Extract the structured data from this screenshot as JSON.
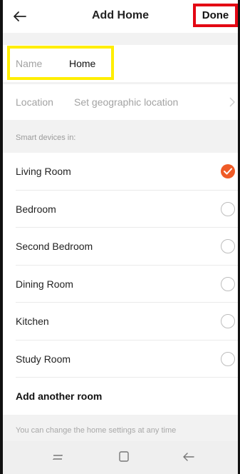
{
  "header": {
    "title": "Add Home",
    "done_label": "Done"
  },
  "name_field": {
    "label": "Name",
    "value": "Home"
  },
  "location_field": {
    "label": "Location",
    "value": "Set geographic location"
  },
  "section": {
    "label": "Smart devices in:"
  },
  "rooms": [
    {
      "label": "Living Room",
      "checked": true
    },
    {
      "label": "Bedroom",
      "checked": false
    },
    {
      "label": "Second Bedroom",
      "checked": false
    },
    {
      "label": "Dining Room",
      "checked": false
    },
    {
      "label": "Kitchen",
      "checked": false
    },
    {
      "label": "Study Room",
      "checked": false
    }
  ],
  "add_room_label": "Add another room",
  "hint": "You can change the home settings at any time",
  "colors": {
    "accent": "#ef5b27",
    "done_highlight": "#e30613",
    "name_highlight": "#ffee00"
  },
  "icons": {
    "back": "arrow-left-icon",
    "chevron": "chevron-right-icon",
    "check": "check-icon",
    "nav_recent": "recent-apps-icon",
    "nav_home": "home-square-icon",
    "nav_back": "nav-back-icon"
  }
}
